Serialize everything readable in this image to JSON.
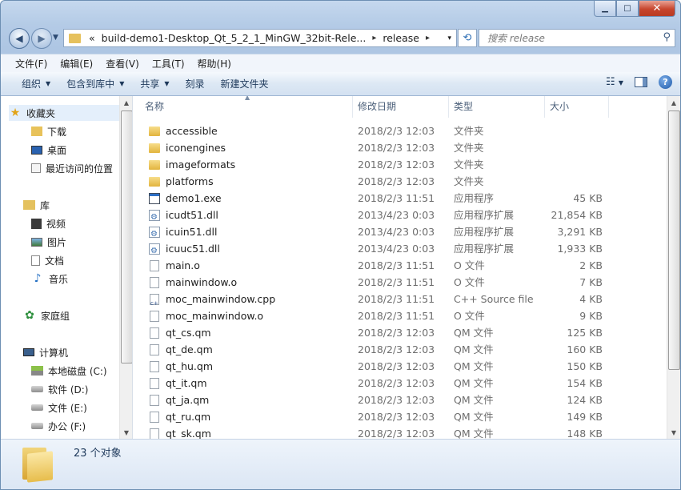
{
  "window": {
    "caption": {
      "minimize": "▁",
      "maximize": "□",
      "close": "✕"
    }
  },
  "address_bar": {
    "overflow": "«",
    "crumbs": [
      "build-demo1-Desktop_Qt_5_2_1_MinGW_32bit-Rele...",
      "release"
    ],
    "separator": "▸",
    "dropdown": "▾",
    "refresh": "⟲"
  },
  "search": {
    "placeholder": "搜索 release",
    "icon": "search-icon"
  },
  "menu": [
    "文件(F)",
    "编辑(E)",
    "查看(V)",
    "工具(T)",
    "帮助(H)"
  ],
  "toolbar": {
    "organize": "组织",
    "include_in_library": "包含到库中",
    "share": "共享",
    "burn": "刻录",
    "new_folder": "新建文件夹",
    "help": "?"
  },
  "nav_pane": {
    "favorites": {
      "label": "收藏夹",
      "items": [
        "下载",
        "桌面",
        "最近访问的位置"
      ]
    },
    "libraries": {
      "label": "库",
      "items": [
        "视频",
        "图片",
        "文档",
        "音乐"
      ]
    },
    "homegroup": "家庭组",
    "computer": {
      "label": "计算机",
      "items": [
        "本地磁盘 (C:)",
        "软件 (D:)",
        "文件 (E:)",
        "办公 (F:)"
      ]
    }
  },
  "columns": {
    "name": "名称",
    "date": "修改日期",
    "type": "类型",
    "size": "大小"
  },
  "files": [
    {
      "name": "accessible",
      "date": "2018/2/3 12:03",
      "type": "文件夹",
      "size": "",
      "icon": "folder"
    },
    {
      "name": "iconengines",
      "date": "2018/2/3 12:03",
      "type": "文件夹",
      "size": "",
      "icon": "folder"
    },
    {
      "name": "imageformats",
      "date": "2018/2/3 12:03",
      "type": "文件夹",
      "size": "",
      "icon": "folder"
    },
    {
      "name": "platforms",
      "date": "2018/2/3 12:03",
      "type": "文件夹",
      "size": "",
      "icon": "folder"
    },
    {
      "name": "demo1.exe",
      "date": "2018/2/3 11:51",
      "type": "应用程序",
      "size": "45 KB",
      "icon": "exe"
    },
    {
      "name": "icudt51.dll",
      "date": "2013/4/23 0:03",
      "type": "应用程序扩展",
      "size": "21,854 KB",
      "icon": "dll"
    },
    {
      "name": "icuin51.dll",
      "date": "2013/4/23 0:03",
      "type": "应用程序扩展",
      "size": "3,291 KB",
      "icon": "dll"
    },
    {
      "name": "icuuc51.dll",
      "date": "2013/4/23 0:03",
      "type": "应用程序扩展",
      "size": "1,933 KB",
      "icon": "dll"
    },
    {
      "name": "main.o",
      "date": "2018/2/3 11:51",
      "type": "O 文件",
      "size": "2 KB",
      "icon": "doc"
    },
    {
      "name": "mainwindow.o",
      "date": "2018/2/3 11:51",
      "type": "O 文件",
      "size": "7 KB",
      "icon": "doc"
    },
    {
      "name": "moc_mainwindow.cpp",
      "date": "2018/2/3 11:51",
      "type": "C++ Source file",
      "size": "4 KB",
      "icon": "cpp"
    },
    {
      "name": "moc_mainwindow.o",
      "date": "2018/2/3 11:51",
      "type": "O 文件",
      "size": "9 KB",
      "icon": "doc"
    },
    {
      "name": "qt_cs.qm",
      "date": "2018/2/3 12:03",
      "type": "QM 文件",
      "size": "125 KB",
      "icon": "doc"
    },
    {
      "name": "qt_de.qm",
      "date": "2018/2/3 12:03",
      "type": "QM 文件",
      "size": "160 KB",
      "icon": "doc"
    },
    {
      "name": "qt_hu.qm",
      "date": "2018/2/3 12:03",
      "type": "QM 文件",
      "size": "150 KB",
      "icon": "doc"
    },
    {
      "name": "qt_it.qm",
      "date": "2018/2/3 12:03",
      "type": "QM 文件",
      "size": "154 KB",
      "icon": "doc"
    },
    {
      "name": "qt_ja.qm",
      "date": "2018/2/3 12:03",
      "type": "QM 文件",
      "size": "124 KB",
      "icon": "doc"
    },
    {
      "name": "qt_ru.qm",
      "date": "2018/2/3 12:03",
      "type": "QM 文件",
      "size": "149 KB",
      "icon": "doc"
    },
    {
      "name": "qt_sk.qm",
      "date": "2018/2/3 12:03",
      "type": "QM 文件",
      "size": "148 KB",
      "icon": "doc"
    }
  ],
  "status": {
    "count": "23 个对象"
  }
}
